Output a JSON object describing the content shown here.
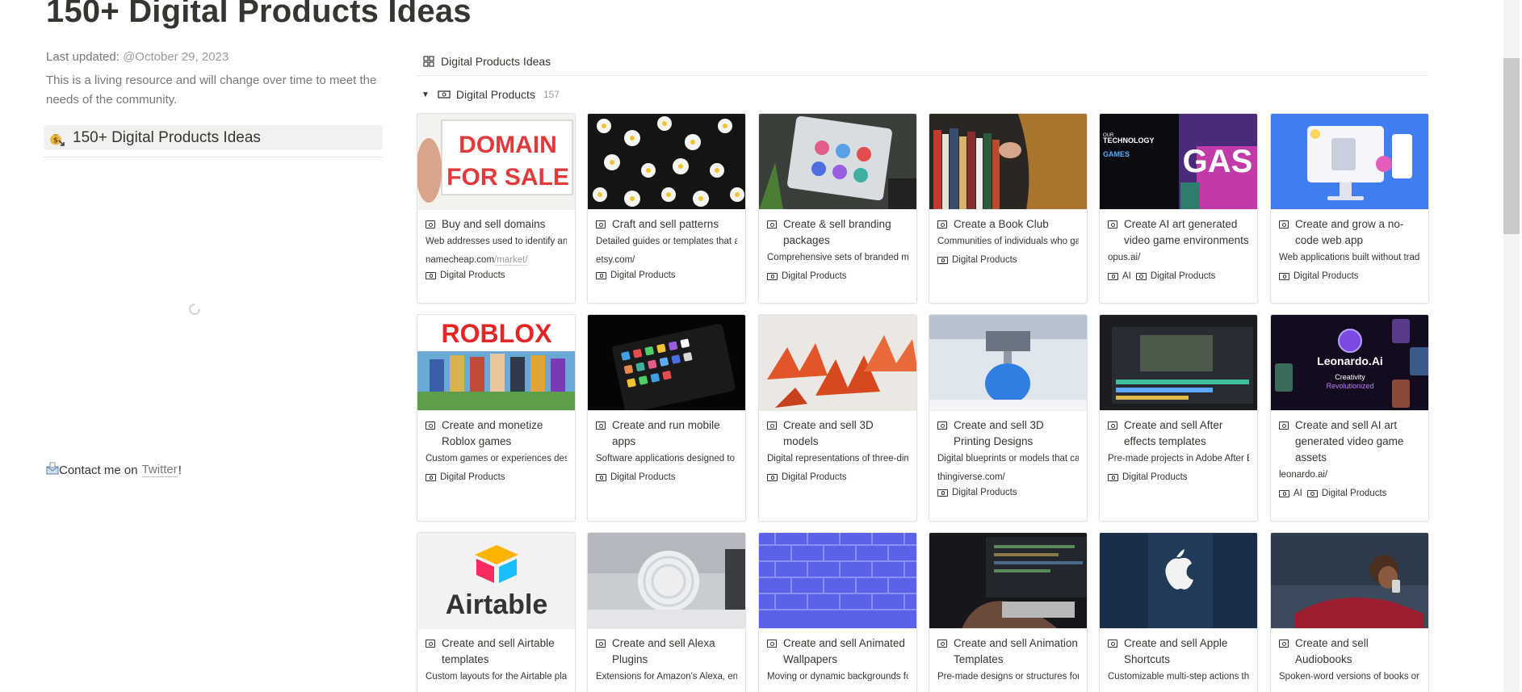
{
  "page": {
    "title": "150+ Digital Products Ideas",
    "updated_label": "Last updated: ",
    "updated_date": "@October 29, 2023",
    "description": "This is a living resource and will change over time to meet the needs of the community.",
    "toc_label": "150+ Digital Products Ideas",
    "contact_prefix": "Contact me on",
    "contact_link": "Twitter",
    "contact_suffix": "!"
  },
  "database": {
    "view_name": "Digital Products Ideas",
    "group_name": "Digital Products",
    "group_count": "157"
  },
  "cards": [
    {
      "title": "Buy and sell domains",
      "desc": "Web addresses used to identify and a",
      "url_host": "namecheap.com",
      "url_path": "/market/",
      "tags": [
        "Digital Products"
      ]
    },
    {
      "title": "Craft and sell patterns",
      "desc": "Detailed guides or templates that assi",
      "url_host": "etsy.com/",
      "url_path": "",
      "tags": [
        "Digital Products"
      ]
    },
    {
      "title": "Create & sell branding packages",
      "desc": "Comprehensive sets of branded mate",
      "url_host": "",
      "url_path": "",
      "tags": [
        "Digital Products"
      ]
    },
    {
      "title": "Create a Book Club",
      "desc": "Communities of individuals who gath",
      "url_host": "",
      "url_path": "",
      "tags": [
        "Digital Products"
      ]
    },
    {
      "title": "Create AI art generated video game environments",
      "desc": "opus.ai/",
      "url_host": "",
      "url_path": "",
      "tags": [
        "AI",
        "Digital Products"
      ]
    },
    {
      "title": "Create and grow a no-code web app",
      "desc": "Web applications built without traditi",
      "url_host": "",
      "url_path": "",
      "tags": [
        "Digital Products"
      ]
    },
    {
      "title": "Create and monetize Roblox games",
      "desc": "Custom games or experiences design",
      "url_host": "",
      "url_path": "",
      "tags": [
        "Digital Products"
      ]
    },
    {
      "title": "Create and run mobile apps",
      "desc": "Software applications designed to run",
      "url_host": "",
      "url_path": "",
      "tags": [
        "Digital Products"
      ]
    },
    {
      "title": "Create and sell 3D models",
      "desc": "Digital representations of three-dimer",
      "url_host": "",
      "url_path": "",
      "tags": [
        "Digital Products"
      ]
    },
    {
      "title": "Create and sell 3D Printing Designs",
      "desc": "Digital blueprints or models that can b",
      "url_host": "thingiverse.com/",
      "url_path": "",
      "tags": [
        "Digital Products"
      ]
    },
    {
      "title": "Create and sell After effects templates",
      "desc": "Pre-made projects in Adobe After Effe",
      "url_host": "",
      "url_path": "",
      "tags": [
        "Digital Products"
      ]
    },
    {
      "title": "Create and sell AI art generated video game assets",
      "desc": "leonardo.ai/",
      "url_host": "",
      "url_path": "",
      "tags": [
        "AI",
        "Digital Products"
      ]
    },
    {
      "title": "Create and sell Airtable templates",
      "desc": "Custom layouts for the Airtable platfo",
      "url_host": "",
      "url_path": "",
      "tags": []
    },
    {
      "title": "Create and sell Alexa Plugins",
      "desc": "Extensions for Amazon's Alexa, enhan",
      "url_host": "",
      "url_path": "",
      "tags": []
    },
    {
      "title": "Create and sell Animated Wallpapers",
      "desc": "Moving or dynamic backgrounds for c",
      "url_host": "",
      "url_path": "",
      "tags": []
    },
    {
      "title": "Create and sell Animation Templates",
      "desc": "Pre-made designs or structures for cr",
      "url_host": "",
      "url_path": "",
      "tags": []
    },
    {
      "title": "Create and sell Apple Shortcuts",
      "desc": "Customizable multi-step actions that",
      "url_host": "",
      "url_path": "",
      "tags": []
    },
    {
      "title": "Create and sell Audiobooks",
      "desc": "Spoken-word versions of books or wr",
      "url_host": "",
      "url_path": "",
      "tags": []
    }
  ],
  "thumbnails": {
    "domain_sign_line1": "DOMAIN",
    "domain_sign_line2": "FOR SALE",
    "roblox_logo": "ROBLOX",
    "airtable_logo": "Airtable",
    "leonardo_logo": "Leonardo.Ai",
    "leonardo_tag1": "Creativity",
    "leonardo_tag2": "Revolutionized",
    "ai_games_text1": "OUR",
    "ai_games_text2": "TECHNOLOGY",
    "ai_games_text3": "GAMES",
    "ai_games_big": "GAS"
  }
}
